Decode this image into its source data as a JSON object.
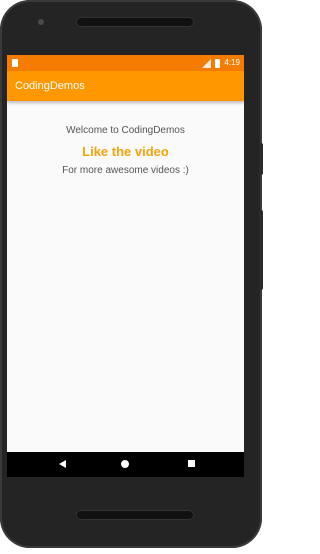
{
  "status_bar": {
    "time": "4:19",
    "bg_color": "#f57c00",
    "icons": [
      "notification-icon",
      "signal-icon",
      "battery-icon"
    ]
  },
  "app_bar": {
    "title": "CodingDemos",
    "bg_color": "#ff9800"
  },
  "content": {
    "welcome": "Welcome to CodingDemos",
    "like": "Like the video",
    "like_color": "#f5a30d",
    "more": "For more awesome videos :)"
  },
  "nav_bar": {
    "icons": [
      "back-icon",
      "home-icon",
      "recent-apps-icon"
    ]
  }
}
